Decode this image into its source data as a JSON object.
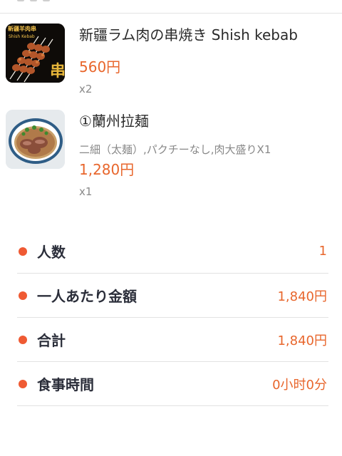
{
  "colors": {
    "accent": "#e8662c",
    "bullet": "#ef5a33",
    "label": "#2b2e3a",
    "muted": "#888888",
    "divider": "#e2e2e2"
  },
  "order_items": [
    {
      "name": "新疆ラム肉の串焼き Shish kebab",
      "options": "",
      "price": "560円",
      "quantity": "x2",
      "thumbnail_text": [
        "新疆羊肉串",
        "Shish Kebab",
        "串"
      ]
    },
    {
      "name": "①蘭州拉麺",
      "options": "二細（太麺）,パクチーなし,肉大盛りX1",
      "price": "1,280円",
      "quantity": "x1"
    }
  ],
  "summary": [
    {
      "label": "人数",
      "value": "1"
    },
    {
      "label": "一人あたり金額",
      "value": "1,840円"
    },
    {
      "label": "合計",
      "value": "1,840円"
    },
    {
      "label": "食事時間",
      "value": "0小时0分"
    }
  ]
}
